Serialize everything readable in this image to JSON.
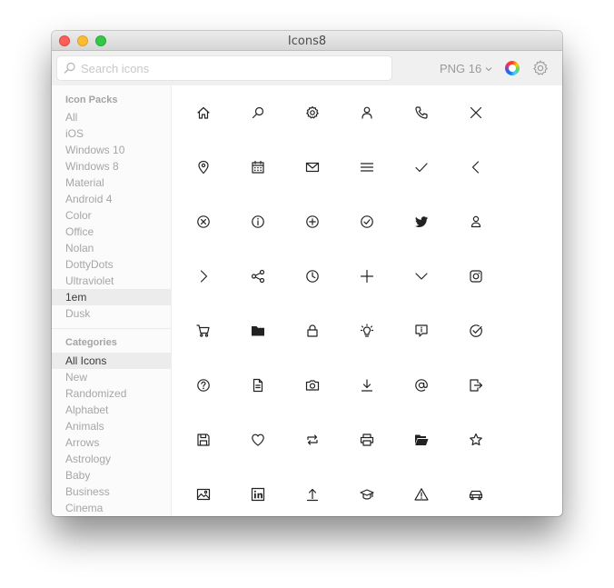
{
  "window": {
    "title": "Icons8"
  },
  "search": {
    "placeholder": "Search icons",
    "value": ""
  },
  "toolbar": {
    "format": "PNG 16"
  },
  "sidebar": {
    "packs_title": "Icon Packs",
    "packs": [
      "All",
      "iOS",
      "Windows 10",
      "Windows 8",
      "Material",
      "Android 4",
      "Color",
      "Office",
      "Nolan",
      "DottyDots",
      "Ultraviolet",
      "1em",
      "Dusk"
    ],
    "selected_pack": "1em",
    "categories_title": "Categories",
    "categories": [
      "All Icons",
      "New",
      "Randomized",
      "Alphabet",
      "Animals",
      "Arrows",
      "Astrology",
      "Baby",
      "Business",
      "Cinema"
    ],
    "selected_category": "All Icons"
  },
  "icons": [
    [
      "home",
      "search",
      "settings",
      "user",
      "phone",
      "close"
    ],
    [
      "marker",
      "calendar",
      "mail",
      "menu",
      "checkmark",
      "chevron-left"
    ],
    [
      "cancel-circle",
      "info-circle",
      "add-circle",
      "ok-circle",
      "twitter",
      "user-alt"
    ],
    [
      "chevron-right",
      "share",
      "clock",
      "plus",
      "chevron-down",
      "instagram"
    ],
    [
      "shopping-cart",
      "folder",
      "lock",
      "idea",
      "comment-info",
      "ok-circle-alt"
    ],
    [
      "help-circle",
      "document",
      "camera",
      "download",
      "at-sign",
      "export"
    ],
    [
      "save",
      "heart",
      "refresh",
      "print",
      "open-folder",
      "star"
    ],
    [
      "picture",
      "linkedin",
      "upload",
      "graduation-cap",
      "warning",
      "car"
    ]
  ]
}
